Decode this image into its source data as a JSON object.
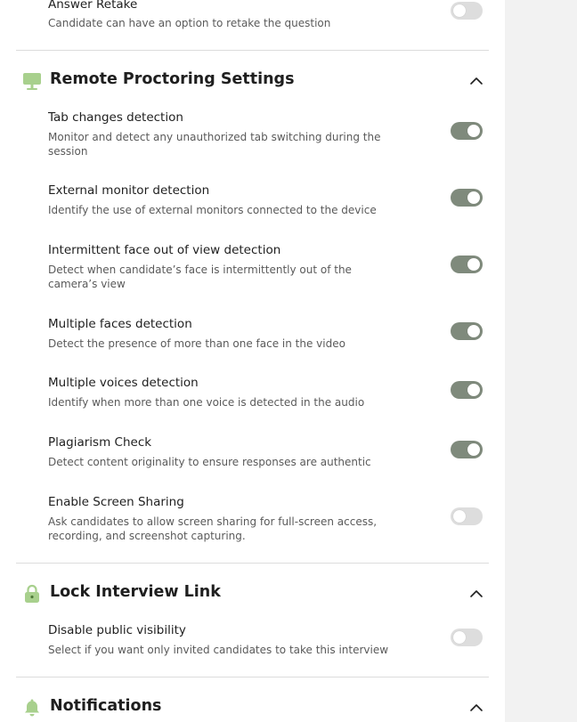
{
  "sections": {
    "retake": {
      "title": "Answer Retake",
      "desc": "Candidate can have an option to retake the question",
      "enabled": false
    },
    "proctoring": {
      "title": "Remote Proctoring Settings",
      "icon": "monitor-icon",
      "expanded": true,
      "items": [
        {
          "title": "Tab changes detection",
          "desc": "Monitor and detect any unauthorized tab switching during the session",
          "enabled": true
        },
        {
          "title": "External monitor detection",
          "desc": "Identify the use of external monitors connected to the device",
          "enabled": true
        },
        {
          "title": "Intermittent face out of view detection",
          "desc": "Detect when candidate’s face is intermittently out of the camera’s view",
          "enabled": true
        },
        {
          "title": "Multiple faces detection",
          "desc": "Detect the presence of more than one face in the video",
          "enabled": true
        },
        {
          "title": "Multiple voices detection",
          "desc": "Identify when more than one voice is detected in the audio",
          "enabled": true
        },
        {
          "title": "Plagiarism Check",
          "desc": "Detect content originality to ensure responses are authentic",
          "enabled": true
        },
        {
          "title": "Enable Screen Sharing",
          "desc": "Ask candidates to allow screen sharing for full-screen access, recording, and screenshot capturing.",
          "enabled": false
        }
      ]
    },
    "lock": {
      "title": "Lock Interview Link",
      "icon": "lock-icon",
      "expanded": true,
      "items": [
        {
          "title": "Disable public visibility",
          "desc": "Select if you want only invited candidates to take this interview",
          "enabled": false
        }
      ]
    },
    "notifications": {
      "title": "Notifications",
      "icon": "bell-icon",
      "expanded": true
    }
  },
  "colors": {
    "toggle_on": "#7f8a7c",
    "toggle_off": "#dddddd",
    "icon_green": "#a8d08d"
  }
}
